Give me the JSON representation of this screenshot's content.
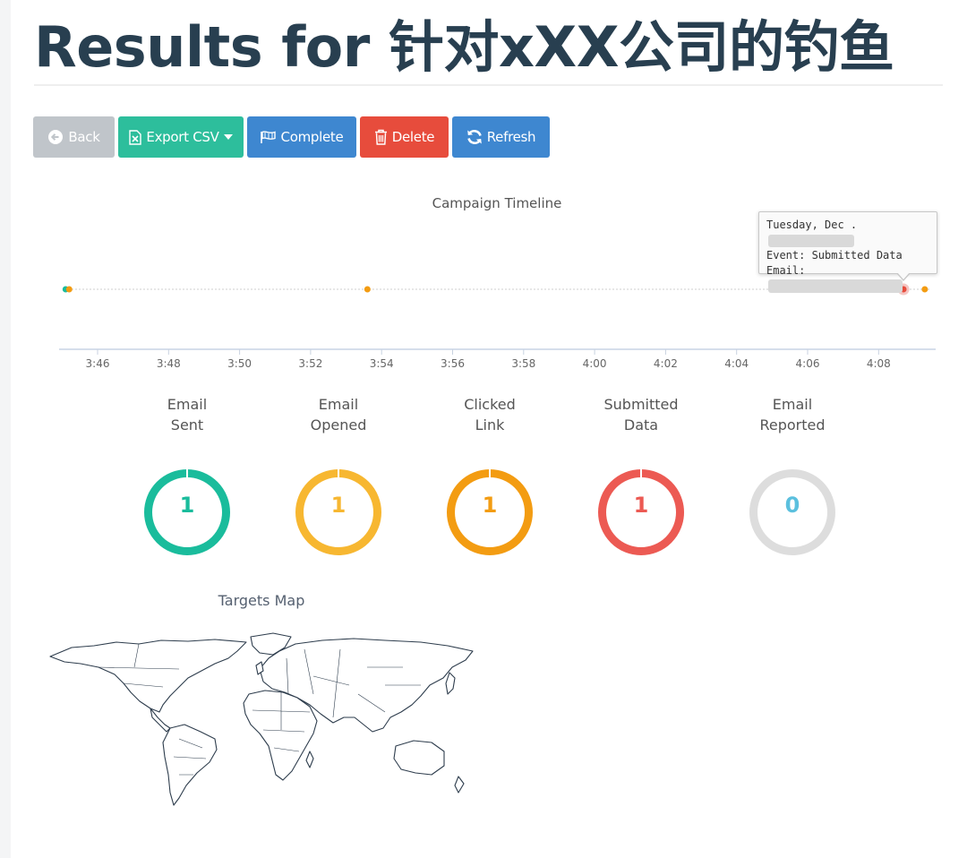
{
  "page": {
    "title": "Results for 针对xXX公司的钓鱼"
  },
  "toolbar": {
    "back_label": "Back",
    "export_label": "Export CSV",
    "complete_label": "Complete",
    "delete_label": "Delete",
    "refresh_label": "Refresh",
    "icons": [
      "back-arrow-icon",
      "file-excel-icon",
      "caret-down-icon",
      "flag-icon",
      "trash-icon",
      "refresh-icon"
    ]
  },
  "timeline": {
    "title": "Campaign Timeline",
    "tick_labels": [
      "3:46",
      "3:48",
      "3:50",
      "3:52",
      "3:54",
      "3:56",
      "3:58",
      "4:00",
      "4:02",
      "4:04",
      "4:06",
      "4:08"
    ],
    "events": [
      {
        "time": "3:45.1",
        "event": "Email Sent",
        "color": "#1abc9c"
      },
      {
        "time": "3:45.2",
        "event": "Email Opened",
        "color": "#f39c12"
      },
      {
        "time": "3:53.6",
        "event": "Clicked Link",
        "color": "#f39c12"
      },
      {
        "time": "4:08.7",
        "event": "Submitted Data",
        "color": "#e74c3c"
      },
      {
        "time": "4:09.3",
        "event": "Email Opened",
        "color": "#f39c12"
      }
    ],
    "tooltip": {
      "line1": "Tuesday, Dec .",
      "line2": "Event: Submitted Data",
      "line3": "Email:"
    }
  },
  "stats": [
    {
      "label": "Email\nSent",
      "count": "1",
      "color": "#1abc9c"
    },
    {
      "label": "Email\nOpened",
      "count": "1",
      "color": "#f7b731"
    },
    {
      "label": "Clicked\nLink",
      "count": "1",
      "color": "#f39c12"
    },
    {
      "label": "Submitted\nData",
      "count": "1",
      "color": "#ec5a53"
    },
    {
      "label": "Email\nReported",
      "count": "0",
      "color": "#dddddd",
      "count_color": "#5bc0de"
    }
  ],
  "map": {
    "title": "Targets Map"
  }
}
